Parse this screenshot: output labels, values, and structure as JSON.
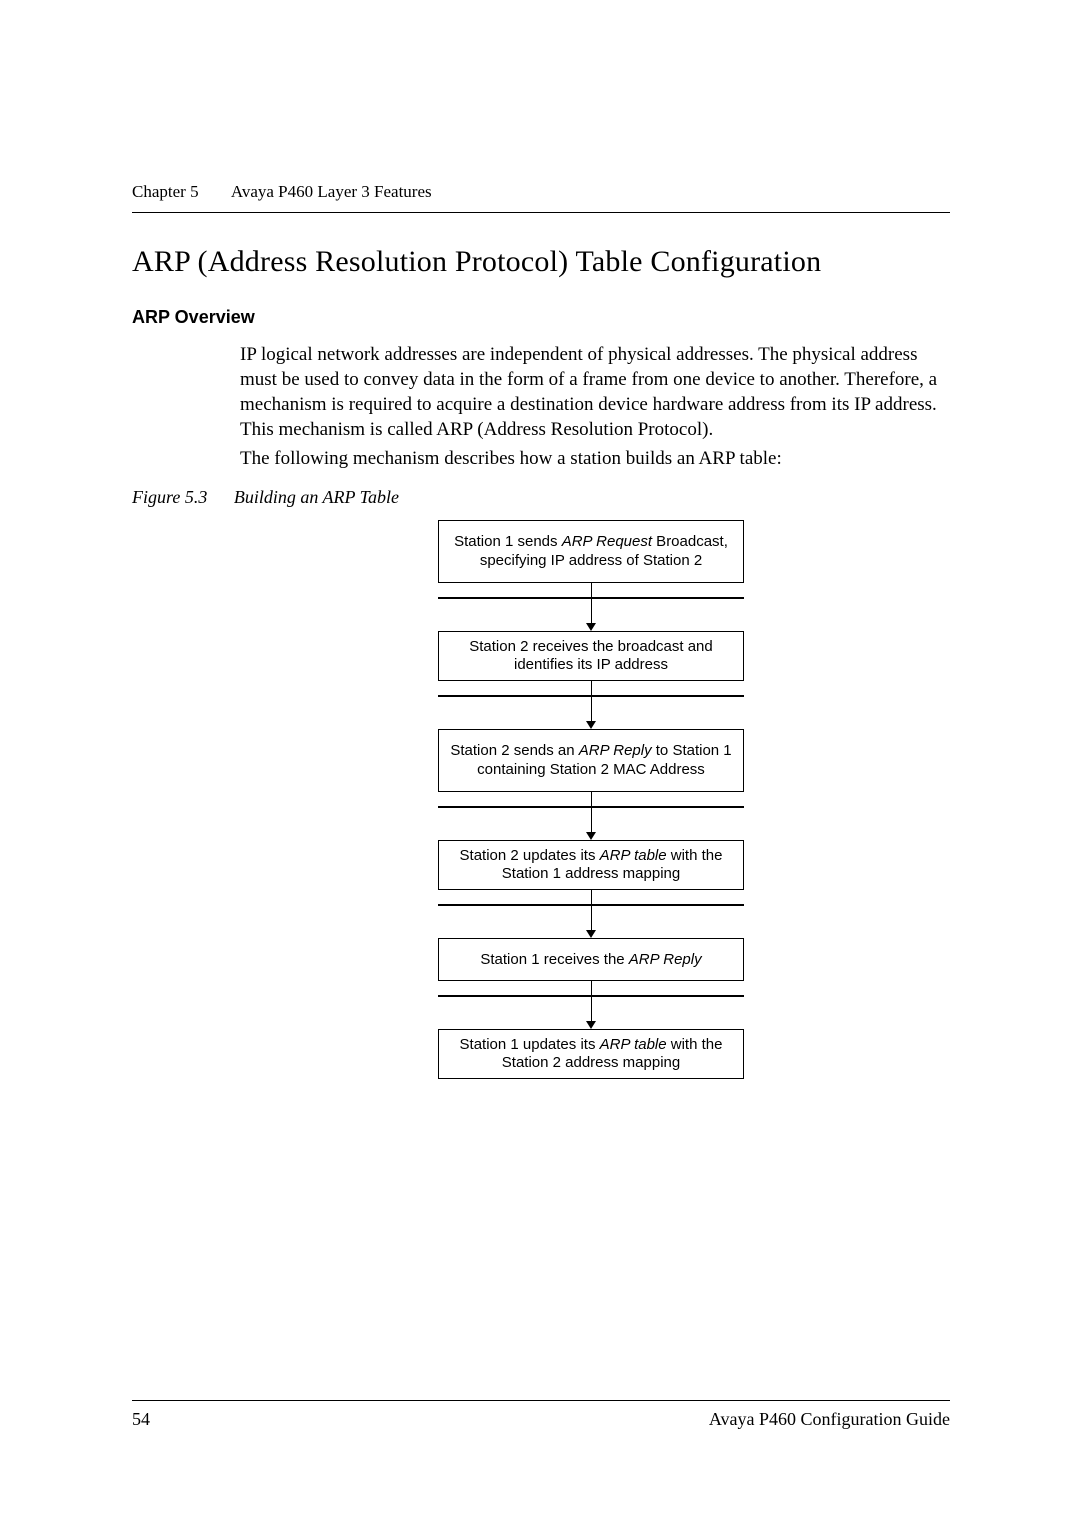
{
  "header": {
    "chapter_label": "Chapter 5",
    "chapter_title": "Avaya P460 Layer 3 Features"
  },
  "section": {
    "title": "ARP (Address Resolution Protocol) Table Configuration",
    "subhead": "ARP Overview",
    "para1": "IP logical network addresses are independent of physical addresses. The physical address must be used to convey data in the form of a frame from one device to another. Therefore, a mechanism is required to acquire a destination device hardware address from its IP address. This mechanism is called ARP (Address Resolution Protocol).",
    "para2": "The following mechanism describes how a station builds an ARP table:"
  },
  "figure": {
    "number": "Figure 5.3",
    "title": "Building an ARP Table",
    "steps": [
      {
        "pre": "Station 1 sends ",
        "em": "ARP Request",
        "post": " Broadcast, specifying IP address of Station 2"
      },
      {
        "pre": "Station 2 receives the broadcast and identifies its IP address",
        "em": "",
        "post": ""
      },
      {
        "pre": "Station 2 sends an ",
        "em": "ARP Reply",
        "post": " to Station 1 containing Station 2 MAC Address"
      },
      {
        "pre": "Station 2 updates its ",
        "em": "ARP table",
        "post": " with the Station 1 address mapping"
      },
      {
        "pre": "Station 1 receives the ",
        "em": "ARP Reply",
        "post": ""
      },
      {
        "pre": "Station 1 updates its ",
        "em": "ARP table",
        "post": " with the Station 2 address mapping"
      }
    ]
  },
  "footer": {
    "page": "54",
    "doc": "Avaya P460 Configuration Guide"
  }
}
